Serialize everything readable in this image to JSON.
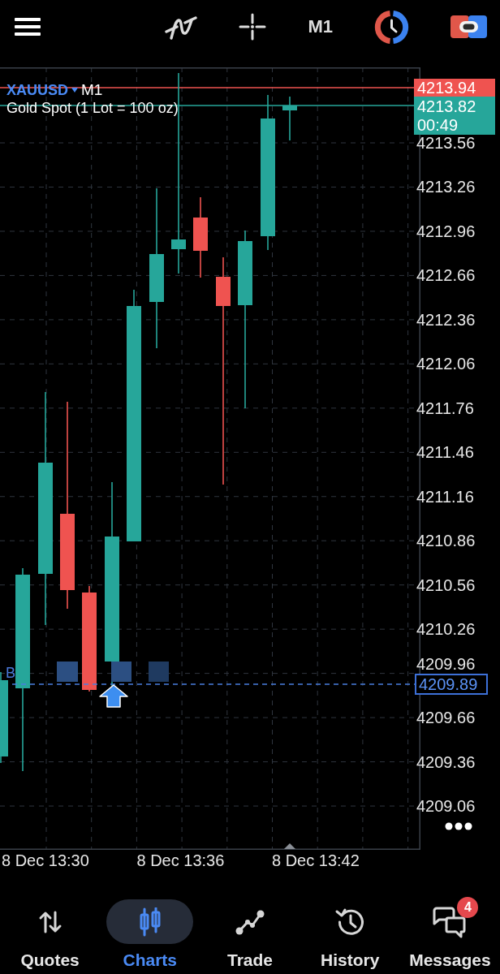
{
  "toolbar": {
    "timeframe": "M1"
  },
  "chart": {
    "symbol": "XAUUSD",
    "timeframe": "M1",
    "description": "Gold Spot (1 Lot = 100 oz)",
    "ask_price": "4213.94",
    "bid_price": "4213.82",
    "bar_countdown": "00:49",
    "order_label": "B",
    "current_price": "4209.89",
    "price_axis": [
      "4213.56",
      "4213.26",
      "4212.96",
      "4212.66",
      "4212.36",
      "4212.06",
      "4211.76",
      "4211.46",
      "4211.16",
      "4210.86",
      "4210.56",
      "4210.26",
      "4209.96",
      "4209.66",
      "4209.36",
      "4209.06"
    ],
    "time_axis": [
      "8 Dec 13:30",
      "8 Dec 13:36",
      "8 Dec 13:42"
    ]
  },
  "bottom_nav": [
    {
      "kind": "quotes",
      "label": "Quotes",
      "selected": false
    },
    {
      "kind": "charts",
      "label": "Charts",
      "selected": true
    },
    {
      "kind": "trade",
      "label": "Trade",
      "selected": false
    },
    {
      "kind": "history",
      "label": "History",
      "selected": false
    },
    {
      "kind": "messages",
      "label": "Messages",
      "selected": false,
      "badge": "4"
    }
  ]
}
